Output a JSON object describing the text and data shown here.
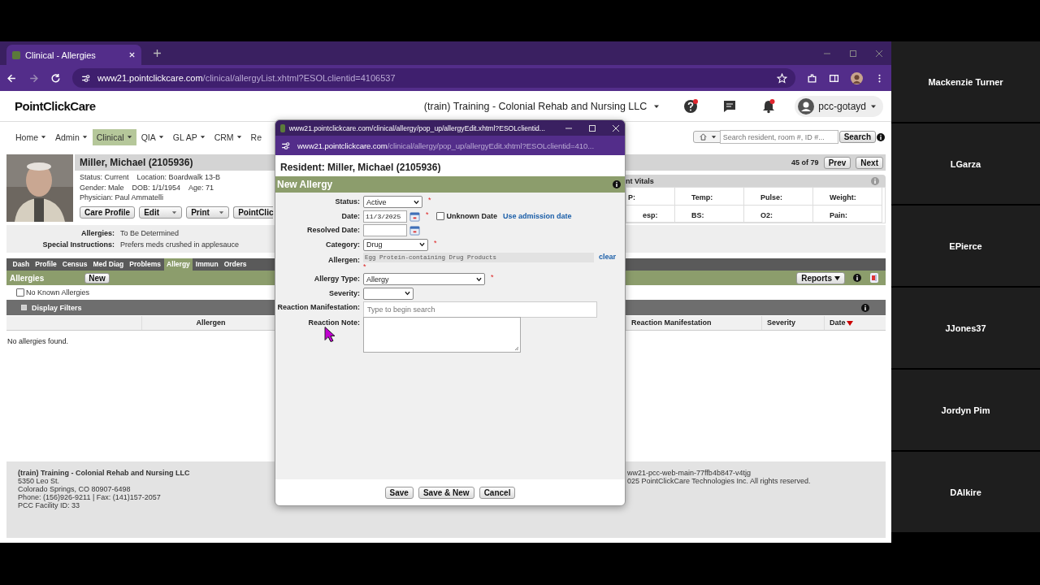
{
  "browser": {
    "tab_title": "Clinical - Allergies",
    "address_host": "www21.pointclickcare.com",
    "address_path": "/clinical/allergyList.xhtml?ESOLclientid=4106537"
  },
  "header": {
    "logo": "PointClickCare",
    "facility": "(train) Training - Colonial Rehab and Nursing LLC",
    "user": "pcc-gotayd"
  },
  "nav": [
    {
      "label": "Home",
      "selected": false,
      "caret": true
    },
    {
      "label": "Admin",
      "selected": false,
      "caret": true
    },
    {
      "label": "Clinical",
      "selected": true,
      "caret": true
    },
    {
      "label": "QIA",
      "selected": false,
      "caret": true
    },
    {
      "label": "GL AP",
      "selected": false,
      "caret": true
    },
    {
      "label": "CRM",
      "selected": false,
      "caret": true
    },
    {
      "label": "Re",
      "selected": false,
      "caret": false
    }
  ],
  "search": {
    "placeholder": "Search resident, room #, ID #...",
    "button": "Search"
  },
  "resident": {
    "name": "Miller, Michael (2105936)",
    "details": [
      [
        "Status: Current",
        "Location: Boardwalk 13-B"
      ],
      [
        "Gender: Male",
        "DOB: 1/1/1954",
        "Age: 71"
      ],
      [
        "Physician: Paul Ammatelli"
      ]
    ],
    "buttons": [
      {
        "label": "Care Profile",
        "kind": "plain"
      },
      {
        "label": "Edit",
        "kind": "split"
      },
      {
        "label": "Print",
        "kind": "split"
      },
      {
        "label": "PointClic",
        "kind": "cut"
      }
    ],
    "notes": [
      {
        "label": "Allergies:",
        "value": "To Be Determined"
      },
      {
        "label": "Special Instructions:",
        "value": "Prefers meds crushed in applesauce"
      }
    ],
    "counter": "45 of 79",
    "prev": "Prev",
    "next": "Next"
  },
  "vitals": {
    "title": "nt Vitals",
    "rows": [
      [
        "P:",
        "Temp:",
        "Pulse:",
        "Weight:"
      ],
      [
        "esp:",
        "BS:",
        "O2:",
        "Pain:"
      ]
    ]
  },
  "tabs": [
    {
      "label": "Dash",
      "selected": false
    },
    {
      "label": "Profile",
      "selected": false
    },
    {
      "label": "Census",
      "selected": false
    },
    {
      "label": "Med Diag",
      "selected": false
    },
    {
      "label": "Problems",
      "selected": false
    },
    {
      "label": "Allergy",
      "selected": true
    },
    {
      "label": "Immun",
      "selected": false
    },
    {
      "label": "Orders",
      "selected": false
    }
  ],
  "allergies": {
    "title": "Allergies",
    "new_button": "New",
    "reports_button": "Reports",
    "no_known": {
      "label": "No Known Allergies",
      "checked": false
    },
    "filters": "Display Filters",
    "columns_left": [
      {
        "label": "Allergen"
      }
    ],
    "columns_right": [
      {
        "label": "Reaction Manifestation",
        "sort_descending": false
      },
      {
        "label": "Severity",
        "sort_descending": false
      },
      {
        "label": "Date",
        "sort_descending": true
      }
    ],
    "empty": "No allergies found."
  },
  "footer": {
    "left": [
      "(train) Training - Colonial Rehab and Nursing LLC",
      "5350 Leo St.",
      "Colorado Springs, CO 80907-6498",
      "Phone: (156)926-9211 | Fax: (141)157-2057",
      "PCC Facility ID: 33"
    ],
    "right": [
      "ww21-pcc-web-main-77ffb4b847-v4tjg",
      "025 PointClickCare Technologies Inc. All rights reserved."
    ]
  },
  "popup": {
    "window_title": "www21.pointclickcare.com/clinical/allergy/pop_up/allergyEdit.xhtml?ESOLclientid...",
    "address_host": "www21.pointclickcare.com",
    "address_path": "/clinical/allergy/pop_up/allergyEdit.xhtml?ESOLclientid=410...",
    "resident": "Resident: Miller, Michael (2105936)",
    "title": "New Allergy",
    "rows": [
      {
        "kind": "select",
        "label": "Status:",
        "value": "Active",
        "required": "*"
      },
      {
        "kind": "date",
        "label": "Date:",
        "value": "11/3/2025",
        "required": "*",
        "checkbox": {
          "label": "Unknown Date",
          "checked": false
        },
        "link": "Use admission date"
      },
      {
        "kind": "date",
        "label": "Resolved Date:"
      },
      {
        "kind": "select",
        "label": "Category:",
        "value": "Drug",
        "required": "*"
      },
      {
        "kind": "allergen",
        "label": "Allergen:",
        "value": "Egg Protein-containing Drug Products",
        "required": "*",
        "link": "clear"
      },
      {
        "kind": "select",
        "label": "Allergy Type:",
        "value": "Allergy",
        "required": "*"
      },
      {
        "kind": "select",
        "label": "Severity:"
      },
      {
        "kind": "search",
        "label": "Reaction Manifestation:",
        "placeholder": "Type to begin search"
      },
      {
        "kind": "textarea",
        "label": "Reaction Note:"
      }
    ],
    "buttons": [
      "Save",
      "Save & New",
      "Cancel"
    ]
  },
  "participants": [
    "Mackenzie Turner",
    "LGarza",
    "EPierce",
    "JJones37",
    "Jordyn Pim",
    "DAlkire"
  ]
}
